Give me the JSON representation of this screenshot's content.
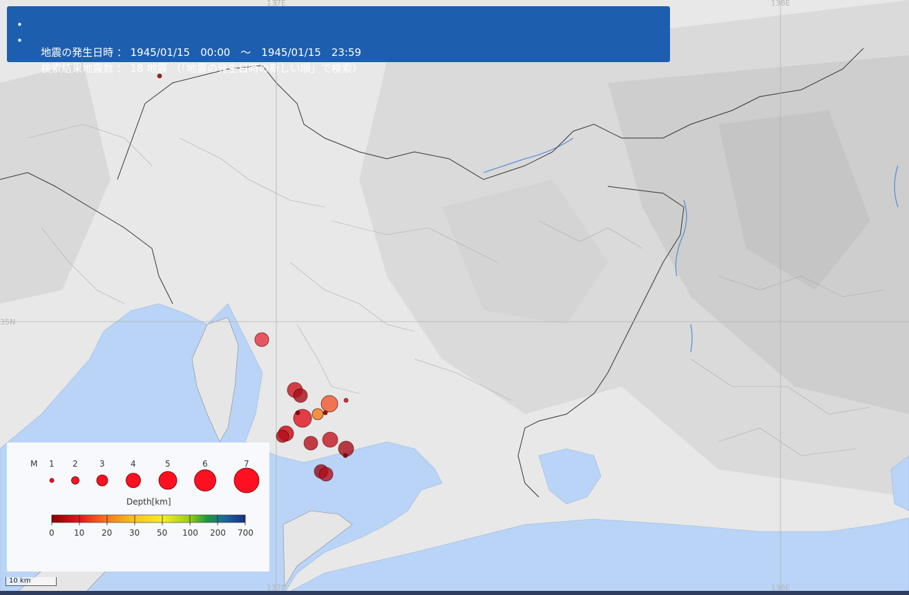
{
  "header": {
    "line1": "地震の発生日時 ： 1945/01/15　00:00　～　1945/01/15　23:59",
    "line2": "検索結果地震数 ： 18 地震 （「地震の発生日時の新しい順」で検索）",
    "bullet": "•"
  },
  "grid_labels": {
    "lon_137": "137E",
    "lon_138": "138E",
    "lat_35": "35N"
  },
  "legend": {
    "magnitude_title": "M",
    "magnitudes": [
      "1",
      "2",
      "3",
      "4",
      "5",
      "6",
      "7"
    ],
    "depth_title": "Depth[km]",
    "depth_ticks": [
      "0",
      "10",
      "20",
      "30",
      "50",
      "100",
      "200",
      "700"
    ],
    "depth_colors": [
      "#8b0000",
      "#e6141e",
      "#f5761e",
      "#f7c21e",
      "#f7ef1e",
      "#9ccf18",
      "#1f9a3a",
      "#1e6a9a",
      "#1a2d8a"
    ]
  },
  "scale_bar": {
    "label": "10 km"
  },
  "colors": {
    "sea": "#b9d4f7",
    "land": "#e9e9e9",
    "header_bg": "#1d5fae"
  },
  "epicenters": [
    {
      "magnitude": 4,
      "depth_band": "10-20"
    },
    {
      "magnitude": 4,
      "depth_band": "0-10"
    },
    {
      "magnitude": 3,
      "depth_band": "0-10"
    },
    {
      "magnitude": 4,
      "depth_band": "10-20"
    },
    {
      "magnitude": 3,
      "depth_band": "20-30"
    },
    {
      "magnitude": 5,
      "depth_band": "0-10"
    },
    {
      "magnitude": 4,
      "depth_band": "0-10"
    },
    {
      "magnitude": 4,
      "depth_band": "0-10"
    },
    {
      "magnitude": 4,
      "depth_band": "0-10"
    },
    {
      "magnitude": 4,
      "depth_band": "0-10"
    },
    {
      "magnitude": 4,
      "depth_band": "0-10"
    },
    {
      "magnitude": 4,
      "depth_band": "0-10"
    },
    {
      "magnitude": 4,
      "depth_band": "0-10"
    },
    {
      "magnitude": 1,
      "depth_band": "0-10"
    },
    {
      "magnitude": 1,
      "depth_band": "0-10"
    },
    {
      "magnitude": 1,
      "depth_band": "0-10"
    },
    {
      "magnitude": 1,
      "depth_band": "0-10"
    },
    {
      "magnitude": 1,
      "depth_band": "0-10"
    }
  ]
}
